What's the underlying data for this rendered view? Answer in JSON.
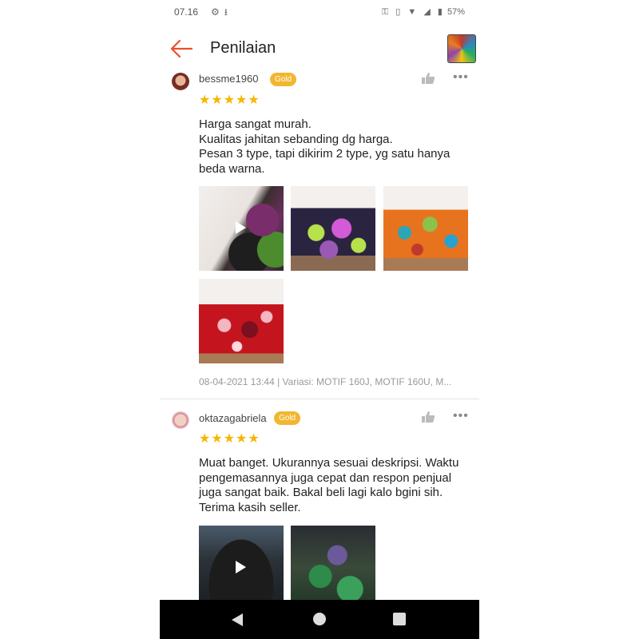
{
  "status_bar": {
    "time": "07.16",
    "battery": "57%"
  },
  "header": {
    "title": "Penilaian"
  },
  "reviews": [
    {
      "username": "bessme1960",
      "badge": "Gold",
      "stars": "★★★★★",
      "text": "Harga sangat murah.\nKualitas jahitan sebanding dg harga.\nPesan 3 type, tapi dikirim 2 type, yg satu hanya beda warna.",
      "meta": "08-04-2021 13:44 | Variasi: MOTIF 160J, MOTIF 160U, M..."
    },
    {
      "username": "oktazagabriela",
      "badge": "Gold",
      "stars": "★★★★★",
      "text": "Muat banget. Ukurannya sesuai deskripsi. Waktu pengemasannya juga cepat dan respon penjual juga sangat baik. Bakal beli lagi kalo bgini sih. Terima kasih seller."
    }
  ],
  "icons": {
    "back": "arrow-left-icon",
    "like": "thumbs-up-icon",
    "more": "more-horizontal-icon",
    "play": "play-icon"
  },
  "colors": {
    "accent": "#ee4d2d",
    "star": "#f7b500",
    "badge": "#f2b630"
  }
}
